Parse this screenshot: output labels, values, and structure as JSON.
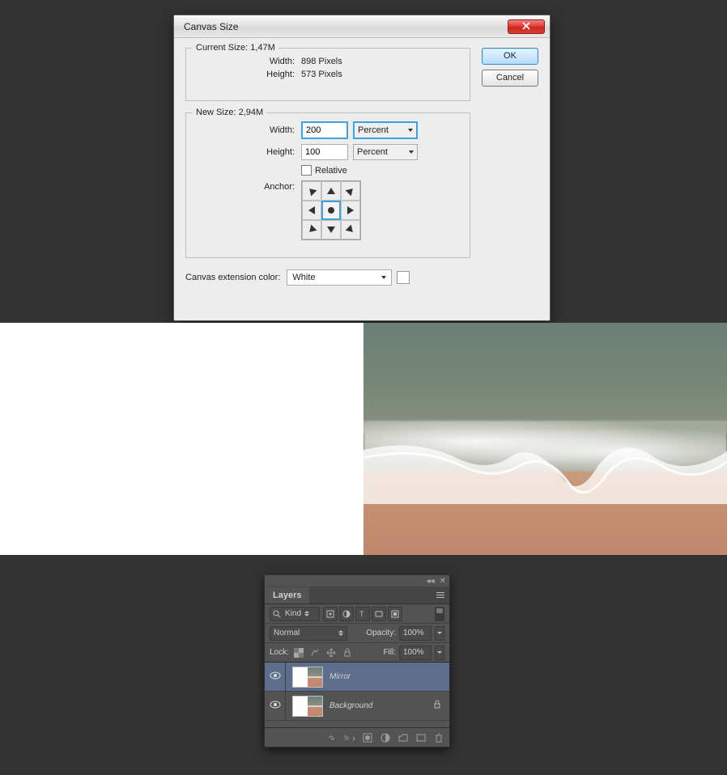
{
  "dialog": {
    "title": "Canvas Size",
    "ok": "OK",
    "cancel": "Cancel",
    "current": {
      "legend": "Current Size: 1,47M",
      "width_label": "Width:",
      "width_value": "898 Pixels",
      "height_label": "Height:",
      "height_value": "573 Pixels"
    },
    "newsize": {
      "legend": "New Size: 2,94M",
      "width_label": "Width:",
      "width_value": "200",
      "width_unit": "Percent",
      "height_label": "Height:",
      "height_value": "100",
      "height_unit": "Percent",
      "relative_label": "Relative",
      "anchor_label": "Anchor:"
    },
    "extension": {
      "label": "Canvas extension color:",
      "value": "White"
    }
  },
  "layers": {
    "tab": "Layers",
    "kind": "Kind",
    "blend_mode": "Normal",
    "opacity_label": "Opacity:",
    "opacity_value": "100%",
    "lock_label": "Lock:",
    "fill_label": "Fill:",
    "fill_value": "100%",
    "items": [
      {
        "name": "Mirror",
        "locked": false,
        "selected": true
      },
      {
        "name": "Background",
        "locked": true,
        "selected": false
      }
    ]
  }
}
